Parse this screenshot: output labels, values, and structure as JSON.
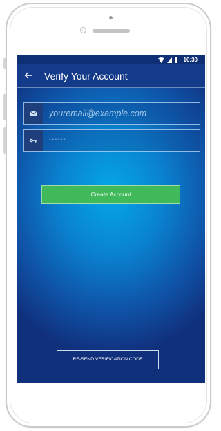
{
  "status_bar": {
    "time": "10:30",
    "icons": [
      "wifi-icon",
      "cell-signal-icon",
      "battery-icon"
    ]
  },
  "app_bar": {
    "title": "Verify Your Account",
    "back_icon": "arrow-left-icon"
  },
  "form": {
    "email": {
      "icon": "envelope-icon",
      "placeholder": "youremail@example.com",
      "value": ""
    },
    "password": {
      "icon": "key-icon",
      "placeholder": "******",
      "value": ""
    },
    "submit_label": "Create Account"
  },
  "footer": {
    "resend_label": "RE-SEND VERIFICATION CODE"
  },
  "colors": {
    "accent_green": "#40b95a",
    "screen_center": "#04a8e6",
    "screen_edge": "#10307c",
    "status_bar": "#0f2f75",
    "app_bar": "#143a8a"
  }
}
